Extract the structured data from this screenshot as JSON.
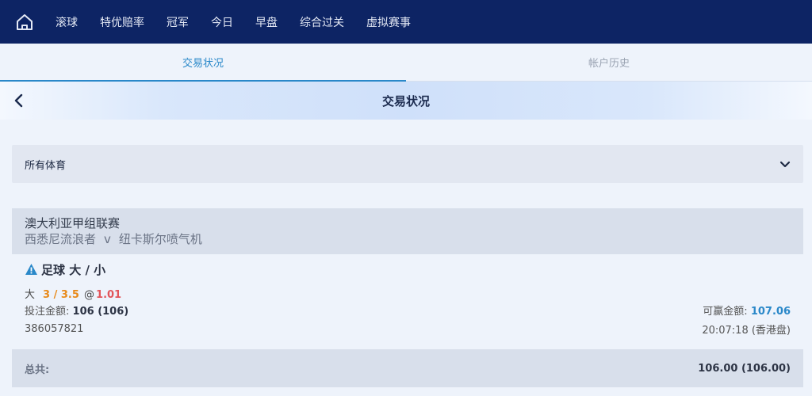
{
  "nav": {
    "items": [
      "滚球",
      "特优赔率",
      "冠军",
      "今日",
      "早盘",
      "综合过关",
      "虚拟赛事"
    ],
    "bg_color": "#0d2464"
  },
  "tabs": [
    {
      "label": "交易状况",
      "active": true
    },
    {
      "label": "帐户历史",
      "active": false
    }
  ],
  "banner": {
    "title": "交易状况"
  },
  "filter": {
    "label": "所有体育"
  },
  "league": {
    "name": "澳大利亚甲组联赛",
    "home": "西悉尼流浪者",
    "vs": "v",
    "away": "纽卡斯尔喷气机"
  },
  "bet": {
    "type": "足球 大 / 小",
    "selection": "大",
    "handicap": "3 / 3.5",
    "at": "@",
    "odds": "1.01",
    "stake_label": "投注金额:",
    "stake_value": "106 (106)",
    "win_label": "可赢金额:",
    "win_value": "107.06",
    "ticket_id": "386057821",
    "time": "20:07:18 (香港盘)"
  },
  "total": {
    "label": "总共:",
    "value": "106.00 (106.00)"
  },
  "colors": {
    "accent": "#2a88c9",
    "handicap": "#e88a1a",
    "odds": "#e2555a"
  }
}
